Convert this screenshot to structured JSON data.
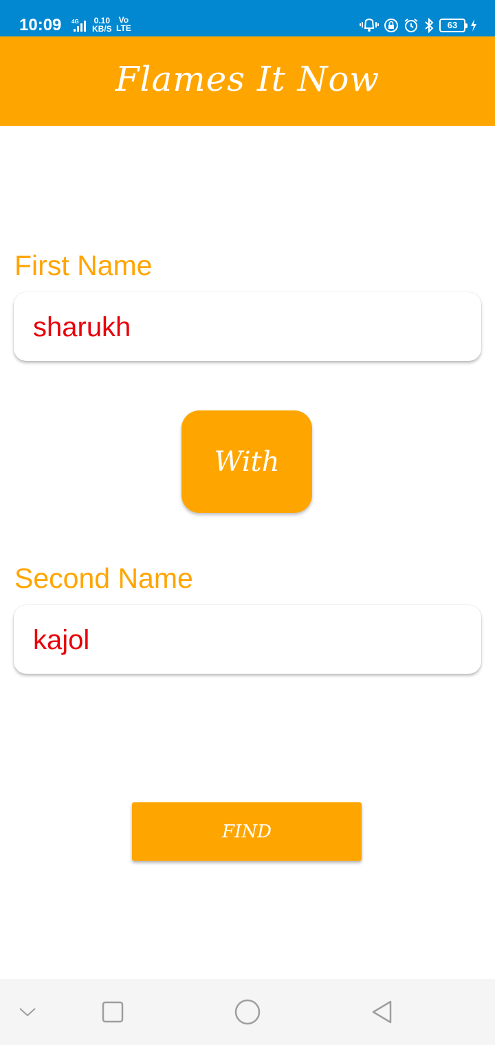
{
  "status_bar": {
    "time": "10:09",
    "network": "4G",
    "speed_value": "0.10",
    "speed_unit": "KB/S",
    "volte_top": "Vo",
    "volte_bottom": "LTE",
    "battery": "63",
    "background_color": "#0288d1",
    "icons": [
      "signal-icon",
      "vibrate-icon",
      "rotation-lock-icon",
      "alarm-icon",
      "bluetooth-icon",
      "battery-icon",
      "charging-icon"
    ]
  },
  "header": {
    "title": "Flames It Now",
    "background_color": "#ffa500"
  },
  "form": {
    "first_name_label": "First Name",
    "first_name_value": "sharukh",
    "with_label": "With",
    "second_name_label": "Second Name",
    "second_name_value": "kajol",
    "find_label": "FIND",
    "label_color": "#ffa500",
    "value_color": "#e8000b"
  },
  "nav_bar": {
    "icons": [
      "chevron-down-icon",
      "recents-square-icon",
      "home-circle-icon",
      "back-triangle-icon"
    ]
  }
}
